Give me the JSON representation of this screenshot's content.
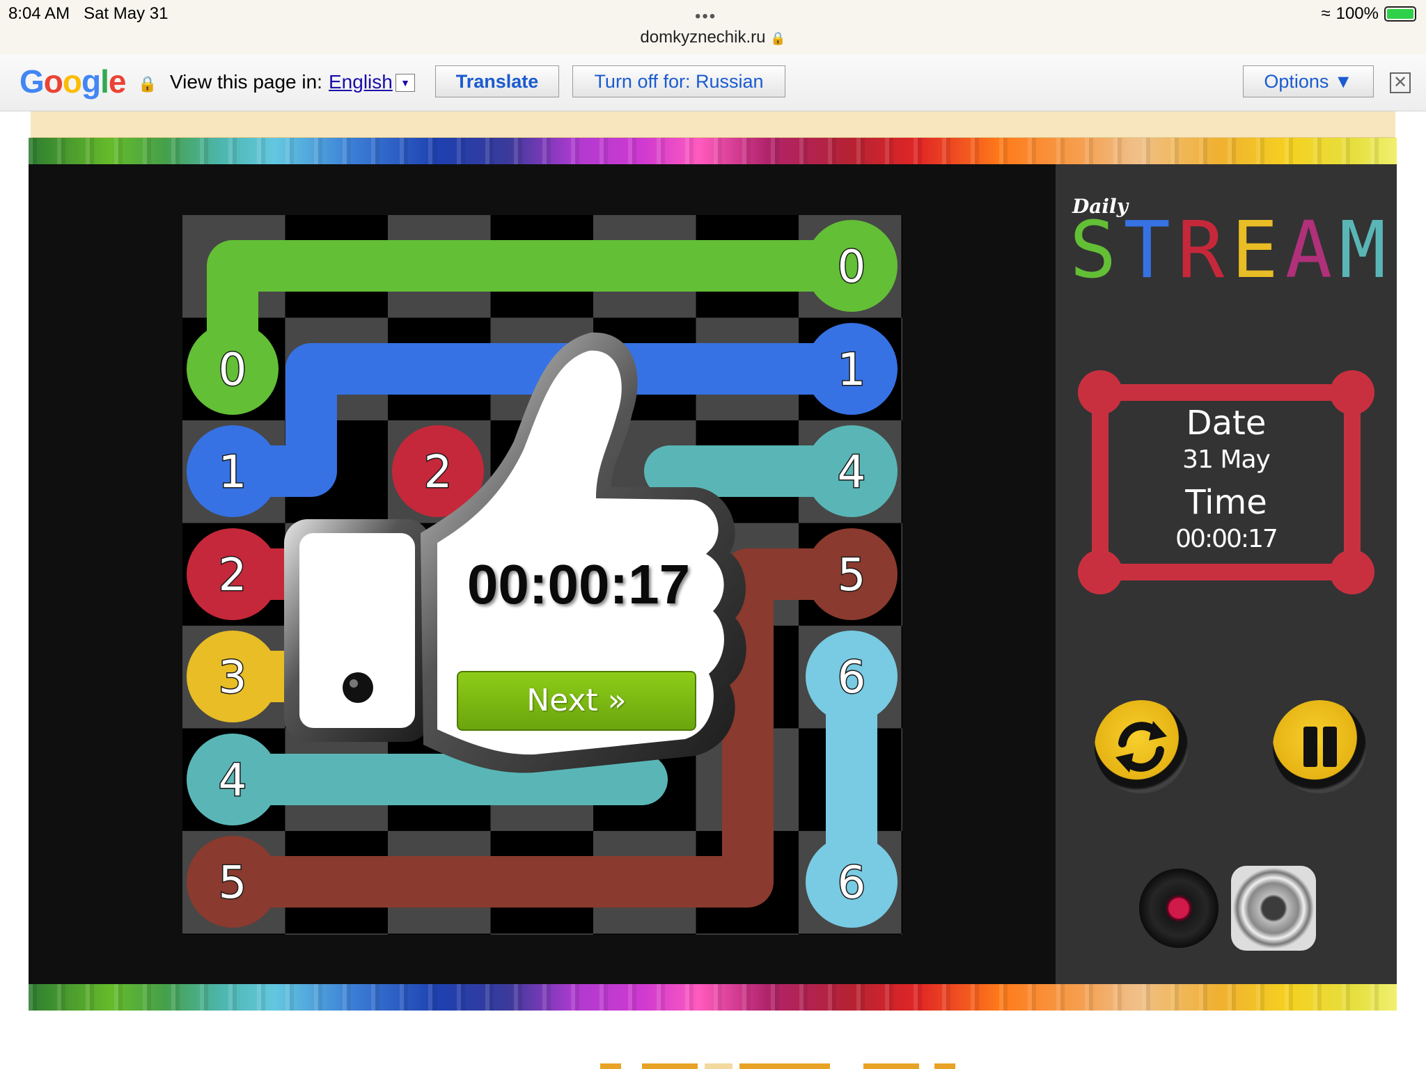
{
  "status_bar": {
    "time": "8:04 AM",
    "date": "Sat May 31",
    "url": "domkyznechik.ru",
    "battery": "100%"
  },
  "translate_bar": {
    "view_label": "View this page in:",
    "language": "English",
    "translate_button": "Translate",
    "turn_off_button": "Turn off for: Russian",
    "options_button": "Options ▼",
    "close": "✕"
  },
  "game": {
    "logo_small": "Daily",
    "logo_big": "STREAM",
    "date_label": "Date",
    "date_value": "31 May",
    "time_label": "Time",
    "time_value": "00:00:17",
    "result_time": "00:00:17",
    "next_button": "Next »",
    "cell_numbers": [
      "0",
      "0",
      "1",
      "1",
      "2",
      "4",
      "2",
      "5",
      "3",
      "6",
      "4",
      "5",
      "6"
    ],
    "colors": {
      "green": "#63bf36",
      "blue": "#3672e4",
      "red": "#c5283a",
      "yellow": "#e8bd25",
      "teal": "#5ab6b6",
      "brown": "#8a3a2e",
      "lightblue": "#78cbe3",
      "frame_red": "#c9303f"
    }
  }
}
